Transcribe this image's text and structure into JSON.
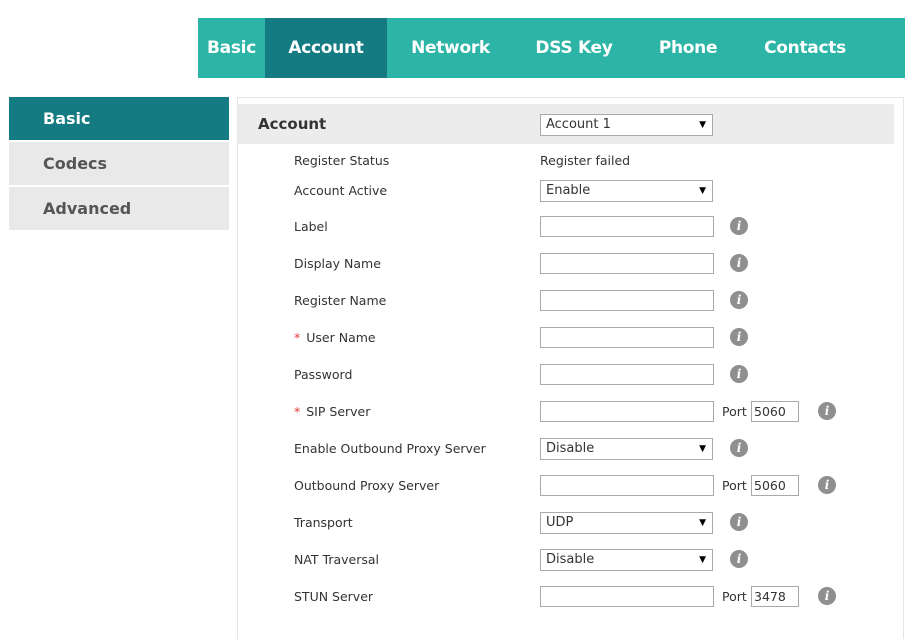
{
  "top_tabs": [
    {
      "label": "Basic"
    },
    {
      "label": "Account",
      "active": true
    },
    {
      "label": "Network"
    },
    {
      "label": "DSS Key"
    },
    {
      "label": "Phone"
    },
    {
      "label": "Contacts"
    }
  ],
  "side_menu": [
    {
      "label": "Basic",
      "active": true
    },
    {
      "label": "Codecs"
    },
    {
      "label": "Advanced"
    }
  ],
  "panel": {
    "title": "Account",
    "account_select": "Account 1"
  },
  "fields": {
    "register_status": {
      "label": "Register Status",
      "value": "Register failed"
    },
    "account_active": {
      "label": "Account Active",
      "value": "Enable"
    },
    "label": {
      "label": "Label",
      "value": ""
    },
    "display_name": {
      "label": "Display Name",
      "value": ""
    },
    "register_name": {
      "label": "Register Name",
      "value": ""
    },
    "user_name": {
      "label": "User Name",
      "required_mark": "*",
      "value": ""
    },
    "password": {
      "label": "Password",
      "value": ""
    },
    "sip_server": {
      "label": "SIP Server",
      "required_mark": "*",
      "value": "",
      "port_label": "Port",
      "port": "5060"
    },
    "enable_outbound_proxy": {
      "label": "Enable Outbound Proxy Server",
      "value": "Disable"
    },
    "outbound_proxy_server": {
      "label": "Outbound Proxy Server",
      "value": "",
      "port_label": "Port",
      "port": "5060"
    },
    "transport": {
      "label": "Transport",
      "value": "UDP"
    },
    "nat_traversal": {
      "label": "NAT Traversal",
      "value": "Disable"
    },
    "stun_server": {
      "label": "STUN Server",
      "value": "",
      "port_label": "Port",
      "port": "3478"
    }
  },
  "icons": {
    "info": "info-icon",
    "select_arrow": "dropdown-arrow-icon",
    "info_glyph": "i",
    "arrow_glyph": "▼"
  },
  "colors": {
    "nav_bg": "#2cb5a6",
    "nav_active": "#147b82",
    "required": "#e53935"
  }
}
